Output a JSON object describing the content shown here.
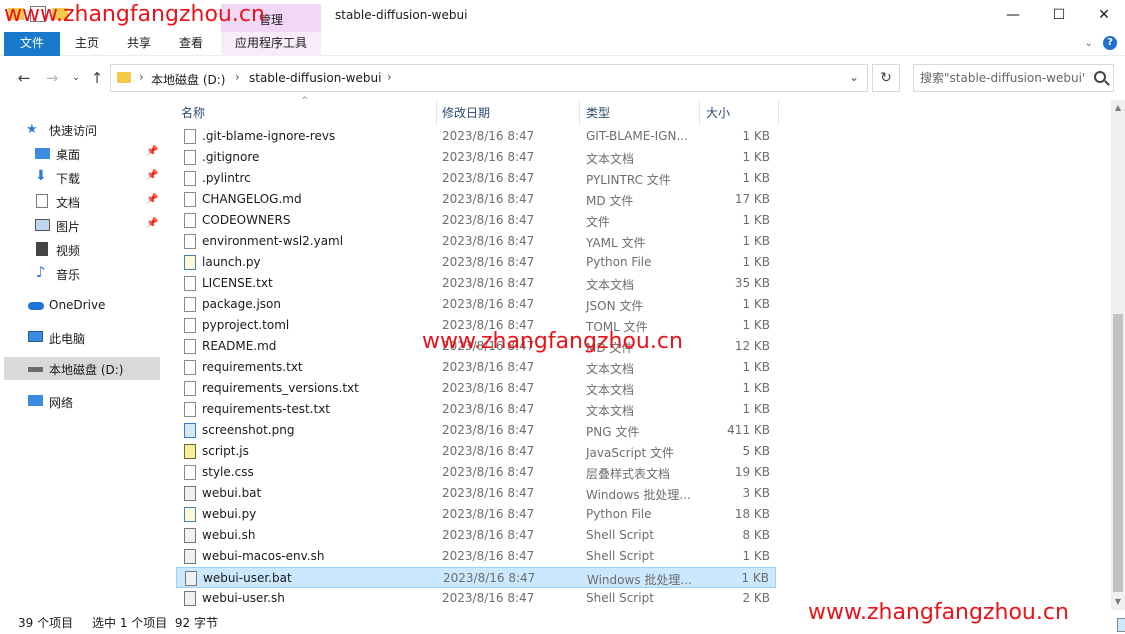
{
  "window": {
    "title": "stable-diffusion-webui",
    "manage_tab": "管理",
    "controls": {
      "minimize": "—",
      "maximize": "☐",
      "close": "✕"
    }
  },
  "ribbon": {
    "tabs": [
      "文件",
      "主页",
      "共享",
      "查看",
      "应用程序工具"
    ],
    "help": "?"
  },
  "address": {
    "crumbs": [
      "本地磁盘 (D:)",
      "stable-diffusion-webui"
    ],
    "search_placeholder": "搜索\"stable-diffusion-webui\""
  },
  "sidebar": {
    "items": [
      {
        "label": "快速访问",
        "icon": "star-icon",
        "pinned": false
      },
      {
        "label": "桌面",
        "icon": "desktop-icon",
        "pinned": true
      },
      {
        "label": "下载",
        "icon": "download-icon",
        "pinned": true
      },
      {
        "label": "文档",
        "icon": "document-icon",
        "pinned": true
      },
      {
        "label": "图片",
        "icon": "picture-icon",
        "pinned": true
      },
      {
        "label": "视频",
        "icon": "video-icon",
        "pinned": false
      },
      {
        "label": "音乐",
        "icon": "music-icon",
        "pinned": false
      },
      {
        "label": "OneDrive",
        "icon": "cloud-icon",
        "pinned": false
      },
      {
        "label": "此电脑",
        "icon": "computer-icon",
        "pinned": false
      },
      {
        "label": "本地磁盘 (D:)",
        "icon": "drive-icon",
        "pinned": false,
        "selected": true
      },
      {
        "label": "网络",
        "icon": "network-icon",
        "pinned": false
      }
    ]
  },
  "columns": {
    "name": "名称",
    "date": "修改日期",
    "type": "类型",
    "size": "大小"
  },
  "files": [
    {
      "name": ".git-blame-ignore-revs",
      "date": "2023/8/16 8:47",
      "type": "GIT-BLAME-IGN...",
      "size": "1 KB",
      "icon": "file-icon"
    },
    {
      "name": ".gitignore",
      "date": "2023/8/16 8:47",
      "type": "文本文档",
      "size": "1 KB",
      "icon": "file-icon"
    },
    {
      "name": ".pylintrc",
      "date": "2023/8/16 8:47",
      "type": "PYLINTRC 文件",
      "size": "1 KB",
      "icon": "file-icon"
    },
    {
      "name": "CHANGELOG.md",
      "date": "2023/8/16 8:47",
      "type": "MD 文件",
      "size": "17 KB",
      "icon": "file-icon"
    },
    {
      "name": "CODEOWNERS",
      "date": "2023/8/16 8:47",
      "type": "文件",
      "size": "1 KB",
      "icon": "file-icon"
    },
    {
      "name": "environment-wsl2.yaml",
      "date": "2023/8/16 8:47",
      "type": "YAML 文件",
      "size": "1 KB",
      "icon": "file-icon"
    },
    {
      "name": "launch.py",
      "date": "2023/8/16 8:47",
      "type": "Python File",
      "size": "1 KB",
      "icon": "python-file-icon"
    },
    {
      "name": "LICENSE.txt",
      "date": "2023/8/16 8:47",
      "type": "文本文档",
      "size": "35 KB",
      "icon": "file-icon"
    },
    {
      "name": "package.json",
      "date": "2023/8/16 8:47",
      "type": "JSON 文件",
      "size": "1 KB",
      "icon": "file-icon"
    },
    {
      "name": "pyproject.toml",
      "date": "2023/8/16 8:47",
      "type": "TOML 文件",
      "size": "1 KB",
      "icon": "file-icon"
    },
    {
      "name": "README.md",
      "date": "2023/8/16 8:47",
      "type": "MD 文件",
      "size": "12 KB",
      "icon": "file-icon"
    },
    {
      "name": "requirements.txt",
      "date": "2023/8/16 8:47",
      "type": "文本文档",
      "size": "1 KB",
      "icon": "file-icon"
    },
    {
      "name": "requirements_versions.txt",
      "date": "2023/8/16 8:47",
      "type": "文本文档",
      "size": "1 KB",
      "icon": "file-icon"
    },
    {
      "name": "requirements-test.txt",
      "date": "2023/8/16 8:47",
      "type": "文本文档",
      "size": "1 KB",
      "icon": "file-icon"
    },
    {
      "name": "screenshot.png",
      "date": "2023/8/16 8:47",
      "type": "PNG 文件",
      "size": "411 KB",
      "icon": "image-file-icon"
    },
    {
      "name": "script.js",
      "date": "2023/8/16 8:47",
      "type": "JavaScript 文件",
      "size": "5 KB",
      "icon": "script-file-icon"
    },
    {
      "name": "style.css",
      "date": "2023/8/16 8:47",
      "type": "层叠样式表文档",
      "size": "19 KB",
      "icon": "file-icon"
    },
    {
      "name": "webui.bat",
      "date": "2023/8/16 8:47",
      "type": "Windows 批处理...",
      "size": "3 KB",
      "icon": "batch-file-icon"
    },
    {
      "name": "webui.py",
      "date": "2023/8/16 8:47",
      "type": "Python File",
      "size": "18 KB",
      "icon": "python-file-icon"
    },
    {
      "name": "webui.sh",
      "date": "2023/8/16 8:47",
      "type": "Shell Script",
      "size": "8 KB",
      "icon": "batch-file-icon"
    },
    {
      "name": "webui-macos-env.sh",
      "date": "2023/8/16 8:47",
      "type": "Shell Script",
      "size": "1 KB",
      "icon": "batch-file-icon"
    },
    {
      "name": "webui-user.bat",
      "date": "2023/8/16 8:47",
      "type": "Windows 批处理...",
      "size": "1 KB",
      "icon": "batch-file-icon",
      "selected": true
    },
    {
      "name": "webui-user.sh",
      "date": "2023/8/16 8:47",
      "type": "Shell Script",
      "size": "2 KB",
      "icon": "batch-file-icon"
    }
  ],
  "status": {
    "item_count": "39 个项目",
    "selection": "选中 1 个项目  92 字节"
  },
  "watermark": "www.zhangfangzhou.cn",
  "colors": {
    "accent": "#1979ca",
    "selection": "#cce8ff",
    "watermark": "#e8131b",
    "manage_tab": "#f1d8f7"
  }
}
